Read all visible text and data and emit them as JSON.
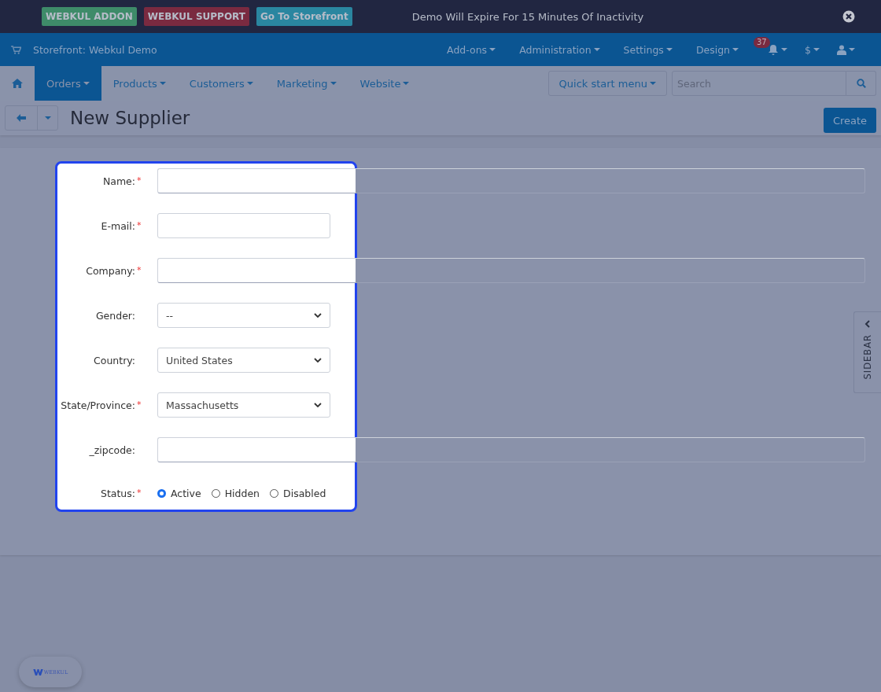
{
  "top_bar": {
    "buttons": [
      {
        "label": "WEBKUL ADDON",
        "color": "#3e8b69"
      },
      {
        "label": "WEBKUL SUPPORT",
        "color": "#7a2a40"
      },
      {
        "label": "Go To Storefront",
        "color": "#2a86a0"
      }
    ],
    "notice": "Demo Will Expire For 15 Minutes Of Inactivity"
  },
  "header": {
    "store": "Storefront: Webkul Demo",
    "menus": [
      "Add-ons",
      "Administration",
      "Settings",
      "Design"
    ],
    "notifications": "37",
    "currency": "$"
  },
  "nav": {
    "tabs": [
      {
        "label": "Orders",
        "selected": true
      },
      {
        "label": "Products",
        "selected": false
      },
      {
        "label": "Customers",
        "selected": false
      },
      {
        "label": "Marketing",
        "selected": false
      },
      {
        "label": "Website",
        "selected": false
      }
    ],
    "quick_menu": "Quick start menu",
    "search": {
      "placeholder": "Search"
    }
  },
  "page": {
    "title": "New Supplier",
    "create": "Create"
  },
  "form": {
    "fields": [
      {
        "label": "Name:",
        "mark": "*",
        "kind": "text",
        "wide": true
      },
      {
        "label": "E-mail:",
        "mark": "*",
        "kind": "text",
        "wide": false
      },
      {
        "label": "Company:",
        "mark": "*",
        "kind": "text",
        "wide": true
      },
      {
        "label": "Gender:",
        "kind": "select",
        "value": "--"
      },
      {
        "label": "Country:",
        "kind": "select",
        "value": "United States"
      },
      {
        "label": "State/Province:",
        "mark": "*",
        "kind": "select",
        "value": "Massachusetts"
      },
      {
        "label": "_zipcode:",
        "kind": "text",
        "wide": true
      }
    ],
    "status": {
      "label": "Status:",
      "mark": "*",
      "options": [
        {
          "label": "Active",
          "selected": true
        },
        {
          "label": "Hidden",
          "selected": false
        },
        {
          "label": "Disabled",
          "selected": false
        }
      ]
    }
  },
  "sidebar_tab": "SIDEBAR",
  "webkul_button": "WEBKUL"
}
